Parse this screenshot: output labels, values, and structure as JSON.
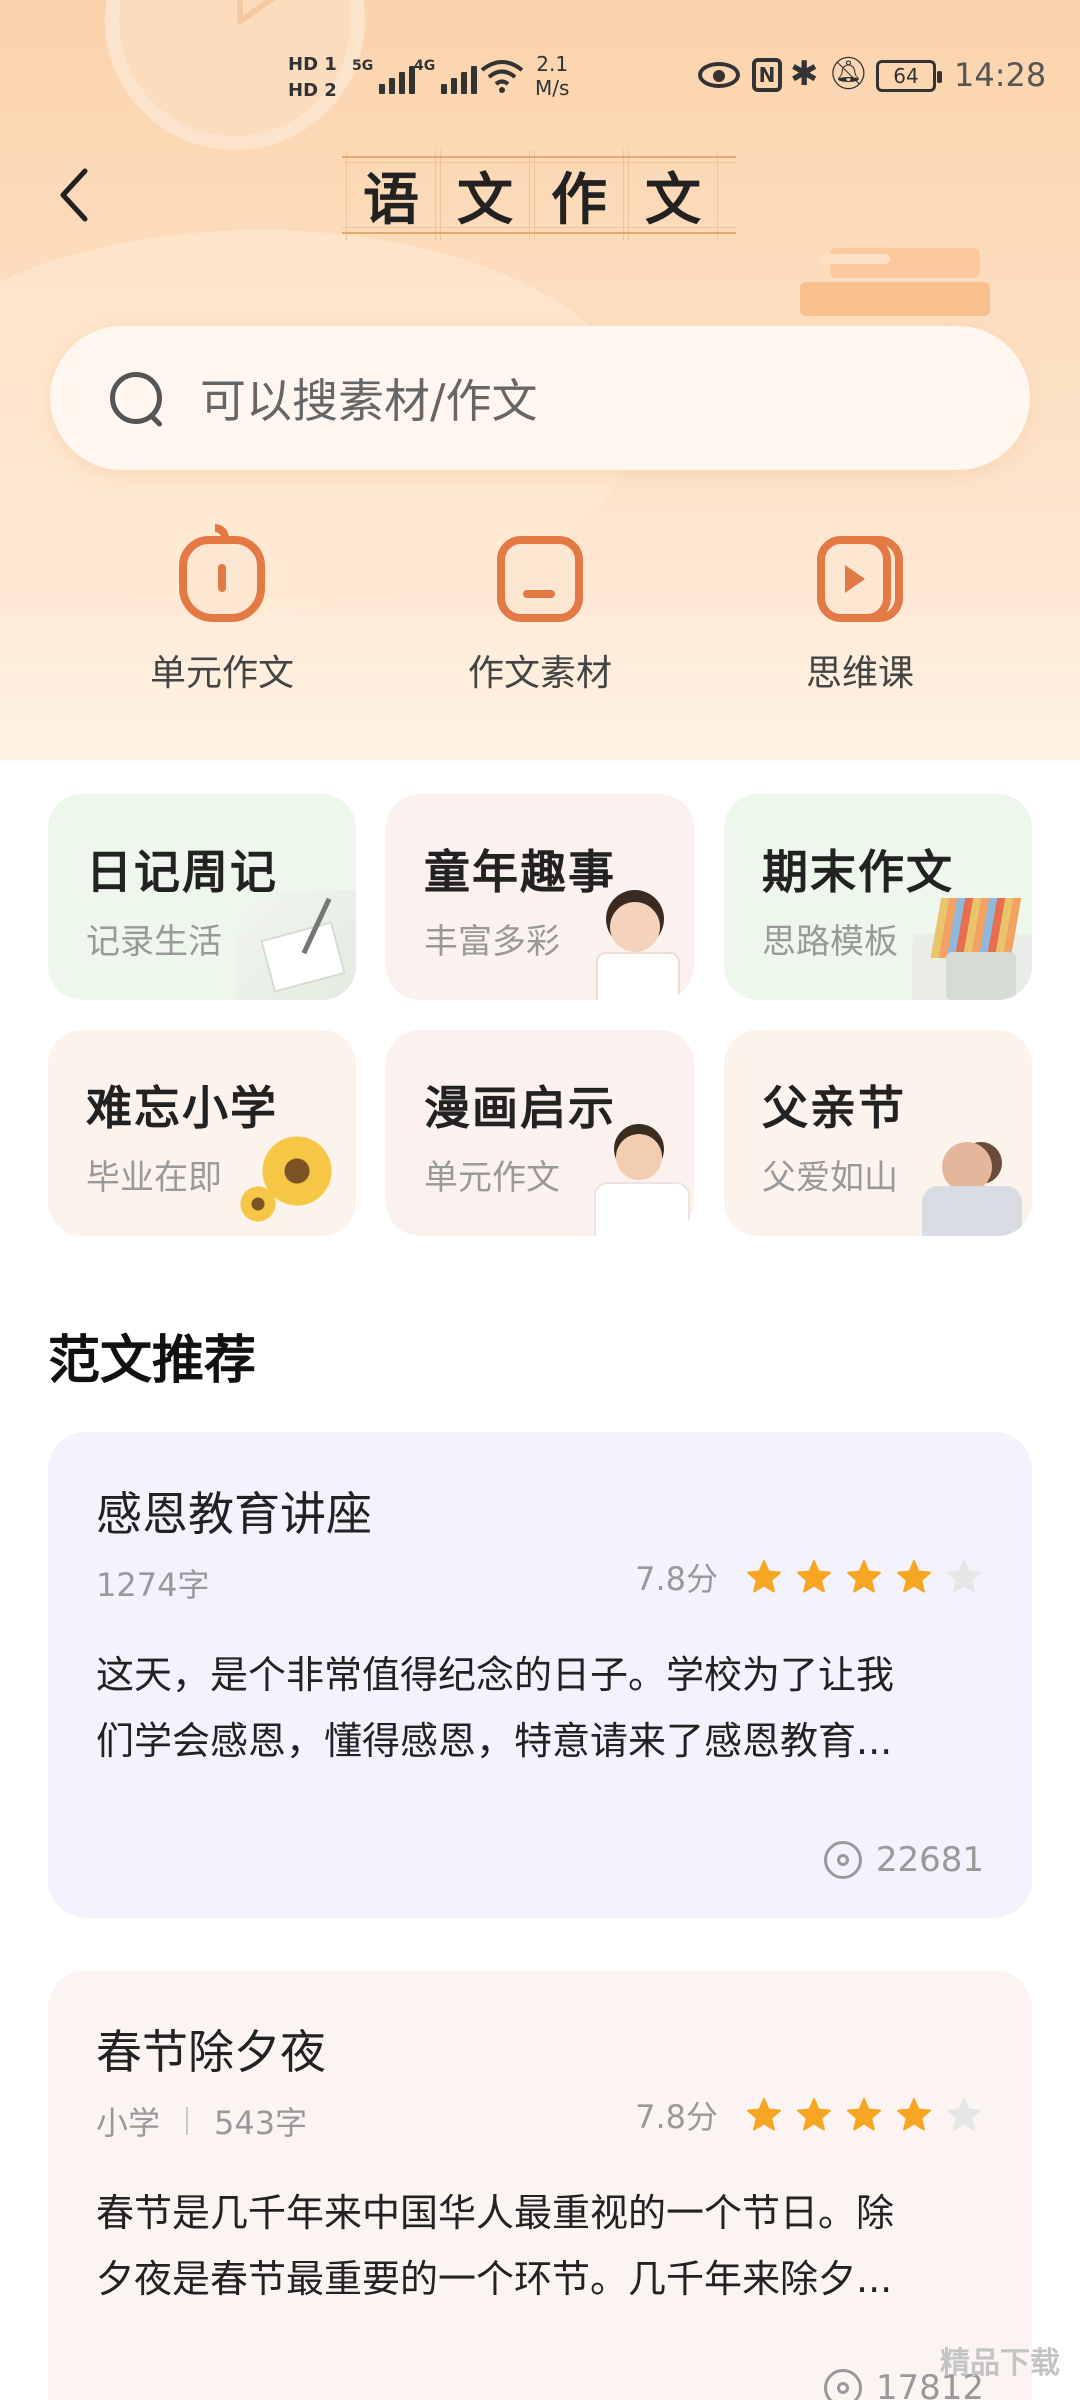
{
  "status_bar": {
    "hd1": "HD 1",
    "hd2": "HD 2",
    "net1": "5G",
    "net2": "4G",
    "speed_value": "2.1",
    "speed_unit": "M/s",
    "nfc": "N",
    "battery": "64",
    "time": "14:28"
  },
  "header": {
    "back_icon": "chevron-left-icon",
    "title_chars": [
      "语",
      "文",
      "作",
      "文"
    ]
  },
  "search": {
    "placeholder": "可以搜素材/作文"
  },
  "quick_entries": [
    {
      "label": "单元作文",
      "icon": "apple-icon"
    },
    {
      "label": "作文素材",
      "icon": "folder-icon"
    },
    {
      "label": "思维课",
      "icon": "video-play-icon"
    }
  ],
  "categories": [
    {
      "title": "日记周记",
      "subtitle": "记录生活"
    },
    {
      "title": "童年趣事",
      "subtitle": "丰富多彩"
    },
    {
      "title": "期末作文",
      "subtitle": "思路模板"
    },
    {
      "title": "难忘小学",
      "subtitle": "毕业在即"
    },
    {
      "title": "漫画启示",
      "subtitle": "单元作文"
    },
    {
      "title": "父亲节",
      "subtitle": "父爱如山"
    }
  ],
  "section": {
    "recommend_title": "范文推荐"
  },
  "articles": [
    {
      "title": "感恩教育讲座",
      "grade": "",
      "word_count": "1274字",
      "score": "7.8分",
      "stars": 4,
      "stars_total": 5,
      "body_line1": "这天，是个非常值得纪念的日子。学校为了让我",
      "body_line2": "们学会感恩，懂得感恩，特意请来了感恩教育...",
      "views": "22681"
    },
    {
      "title": "春节除夕夜",
      "grade": "小学",
      "word_count": "543字",
      "score": "7.8分",
      "stars": 4,
      "stars_total": 5,
      "body_line1": "春节是几千年来中国华人最重视的一个节日。除",
      "body_line2": "夕夜是春节最重要的一个环节。几千年来除夕...",
      "views": "17812"
    }
  ],
  "colors": {
    "accent": "#e37a45",
    "star_on": "#f6a623",
    "star_off": "#e6e6e6"
  }
}
